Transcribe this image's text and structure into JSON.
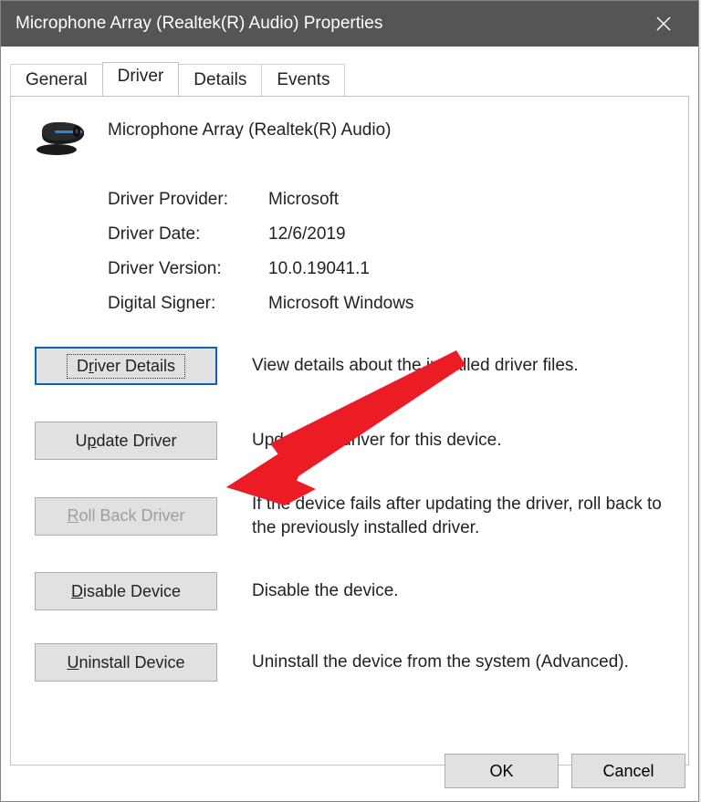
{
  "window": {
    "title": "Microphone Array (Realtek(R) Audio) Properties"
  },
  "tabs": {
    "general": "General",
    "driver": "Driver",
    "details": "Details",
    "events": "Events",
    "active": "driver"
  },
  "device": {
    "name": "Microphone Array (Realtek(R) Audio)"
  },
  "info": {
    "provider_label": "Driver Provider:",
    "provider_value": "Microsoft",
    "date_label": "Driver Date:",
    "date_value": "12/6/2019",
    "version_label": "Driver Version:",
    "version_value": "10.0.19041.1",
    "signer_label": "Digital Signer:",
    "signer_value": "Microsoft Windows"
  },
  "actions": {
    "driver_details": {
      "label_pre": "D",
      "label_u": "r",
      "label_post": "iver Details",
      "desc": "View details about the installed driver files."
    },
    "update_driver": {
      "label_pre": "U",
      "label_u": "p",
      "label_post": "date Driver",
      "desc": "Update the driver for this device."
    },
    "roll_back": {
      "label_pre": "",
      "label_u": "R",
      "label_post": "oll Back Driver",
      "desc": "If the device fails after updating the driver, roll back to the previously installed driver."
    },
    "disable": {
      "label_pre": "",
      "label_u": "D",
      "label_post": "isable Device",
      "desc": "Disable the device."
    },
    "uninstall": {
      "label_pre": "",
      "label_u": "U",
      "label_post": "ninstall Device",
      "desc": "Uninstall the device from the system (Advanced)."
    }
  },
  "bottom": {
    "ok": "OK",
    "cancel": "Cancel"
  }
}
